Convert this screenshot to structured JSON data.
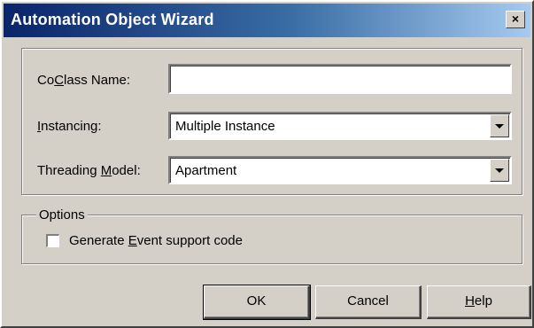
{
  "window": {
    "title": "Automation Object Wizard",
    "close_glyph": "×",
    "close_icon": "close-icon"
  },
  "fields": {
    "coclass_name": {
      "label_pre": "Co",
      "label_accel": "C",
      "label_post": "lass Name:",
      "value": ""
    },
    "instancing": {
      "label_pre": "",
      "label_accel": "I",
      "label_post": "nstancing:",
      "value": "Multiple Instance",
      "dropdown_icon": "chevron-down-icon"
    },
    "threading_model": {
      "label_pre": "Threading ",
      "label_accel": "M",
      "label_post": "odel:",
      "value": "Apartment",
      "dropdown_icon": "chevron-down-icon"
    }
  },
  "options": {
    "group_label": "Options",
    "event_support": {
      "label_pre": "Generate ",
      "label_accel": "E",
      "label_post": "vent support code",
      "checked": false
    }
  },
  "buttons": {
    "ok": "OK",
    "cancel": "Cancel",
    "help_accel": "H",
    "help_post": "elp"
  },
  "colors": {
    "title_gradient_start": "#0a246a",
    "title_gradient_end": "#a6caf0",
    "dialog_face": "#d4d0c8"
  }
}
